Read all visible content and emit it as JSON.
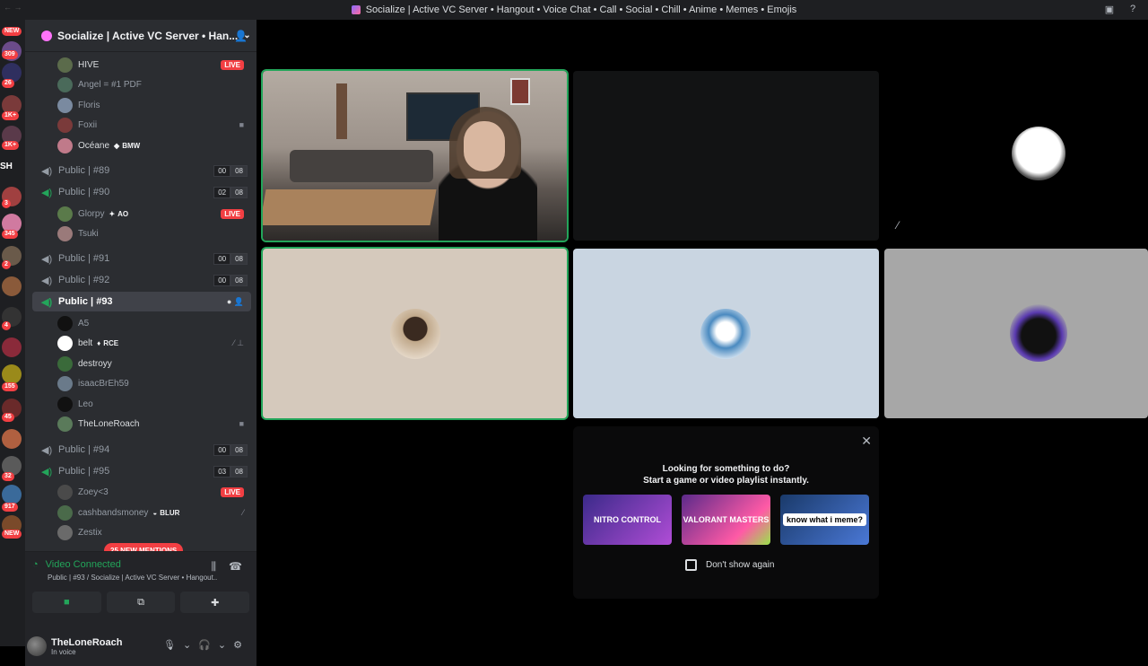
{
  "window": {
    "title": "Socialize | Active VC Server • Hangout • Voice Chat • Call • Social • Chill • Anime • Memes • Emojis",
    "back_glyph": "← →"
  },
  "guild_rail": {
    "badges": [
      {
        "label": "NEW"
      },
      {
        "label": "309"
      },
      {
        "label": "26"
      },
      {
        "label": "1K+"
      },
      {
        "label": "1K+"
      },
      {
        "label": "3"
      },
      {
        "label": "345"
      },
      {
        "label": "2"
      },
      {
        "label": "4"
      },
      {
        "label": "155"
      },
      {
        "label": "45"
      },
      {
        "label": "32"
      },
      {
        "label": "917"
      },
      {
        "label": "NEW"
      }
    ],
    "folder_label": "SH"
  },
  "server": {
    "name": "Socialize | Active VC Server • Han..."
  },
  "channels": [
    {
      "type": "user",
      "name": "HIVE",
      "live": "LIVE"
    },
    {
      "type": "user",
      "name": "Angel = #1 PDF"
    },
    {
      "type": "user",
      "name": "Floris"
    },
    {
      "type": "user",
      "name": "Foxii",
      "icon": "camera-icon"
    },
    {
      "type": "user",
      "name": "Océane",
      "tag": "BMW"
    },
    {
      "type": "voice",
      "name": "Public | #89",
      "count_a": "00",
      "count_b": "08"
    },
    {
      "type": "voice",
      "name": "Public | #90",
      "count_a": "02",
      "count_b": "08"
    },
    {
      "type": "user",
      "name": "Glorpy",
      "tag": "AO",
      "live": "LIVE"
    },
    {
      "type": "user",
      "name": "Tsuki"
    },
    {
      "type": "voice",
      "name": "Public | #91",
      "count_a": "00",
      "count_b": "08"
    },
    {
      "type": "voice",
      "name": "Public | #92",
      "count_a": "00",
      "count_b": "08"
    },
    {
      "type": "voice",
      "name": "Public | #93",
      "active": true
    },
    {
      "type": "user",
      "name": "A5"
    },
    {
      "type": "user",
      "name": "belt",
      "tag": "RCE"
    },
    {
      "type": "user",
      "name": "destroyy"
    },
    {
      "type": "user",
      "name": "isaacBrEh59"
    },
    {
      "type": "user",
      "name": "Leo"
    },
    {
      "type": "user",
      "name": "TheLoneRoach",
      "icon": "camera-icon"
    },
    {
      "type": "voice",
      "name": "Public | #94",
      "count_a": "00",
      "count_b": "08"
    },
    {
      "type": "voice",
      "name": "Public | #95",
      "count_a": "03",
      "count_b": "08"
    },
    {
      "type": "user",
      "name": "Zoey<3",
      "live": "LIVE"
    },
    {
      "type": "user",
      "name": "cashbandsmoney",
      "tag": "BLUR"
    },
    {
      "type": "user",
      "name": "Zestix"
    }
  ],
  "mentions_pill": "25 NEW MENTIONS",
  "voice_panel": {
    "status": "Video Connected",
    "sub": "Public | #93 / Socialize | Active VC Server • Hangout..."
  },
  "user_panel": {
    "username": "TheLoneRoach",
    "status": "In voice"
  },
  "activity_prompt": {
    "title": "Looking for something to do?",
    "subtitle": "Start a game or video playlist instantly.",
    "cards": [
      {
        "label": "NITRO CONTROL"
      },
      {
        "label": "VALORANT MASTERS"
      },
      {
        "label": "know what i meme?"
      }
    ],
    "checkbox_label": "Don't show again"
  },
  "colors": {
    "accent_green": "#23a55a",
    "live_red": "#f23f43",
    "sidebar_bg": "#2b2d31"
  }
}
